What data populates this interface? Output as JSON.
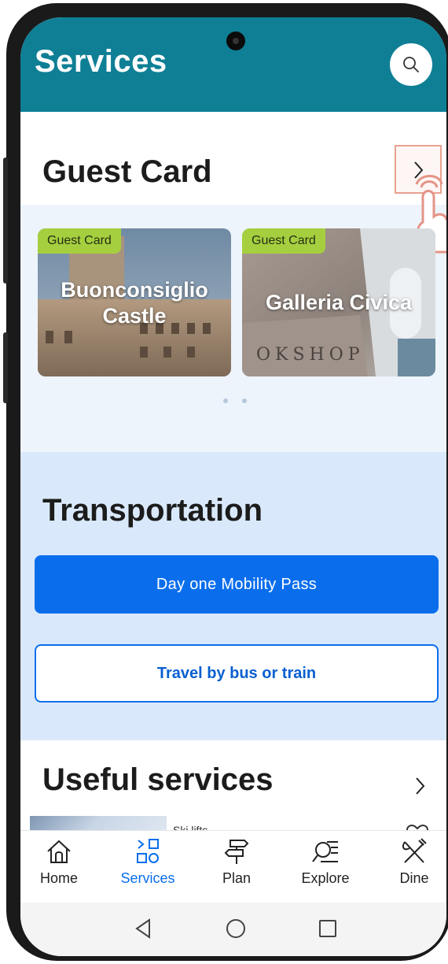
{
  "header": {
    "title": "Services",
    "search_icon": "search-icon"
  },
  "guest_section": {
    "title": "Guest Card",
    "cards": [
      {
        "badge": "Guest Card",
        "title_line1": "Buonconsiglio",
        "title_line2": "Castle"
      },
      {
        "badge": "Guest Card",
        "title_line1": "Galleria Civica",
        "image_text": "OKSHOP"
      }
    ]
  },
  "transport_section": {
    "title": "Transportation",
    "primary_button": "Day one Mobility Pass",
    "secondary_button": "Travel by bus or train"
  },
  "useful_section": {
    "title": "Useful services",
    "item_label": "Ski lifts"
  },
  "bottom_nav": {
    "items": [
      {
        "label": "Home",
        "icon": "home-icon"
      },
      {
        "label": "Services",
        "icon": "services-icon",
        "active": true
      },
      {
        "label": "Plan",
        "icon": "signpost-icon"
      },
      {
        "label": "Explore",
        "icon": "explore-icon"
      },
      {
        "label": "Dine",
        "icon": "fork-knife-icon"
      }
    ]
  },
  "colors": {
    "header": "#0f7f95",
    "primary": "#0a6eec",
    "badge": "#a6cf3f",
    "transport_bg": "#d9e9fb"
  }
}
